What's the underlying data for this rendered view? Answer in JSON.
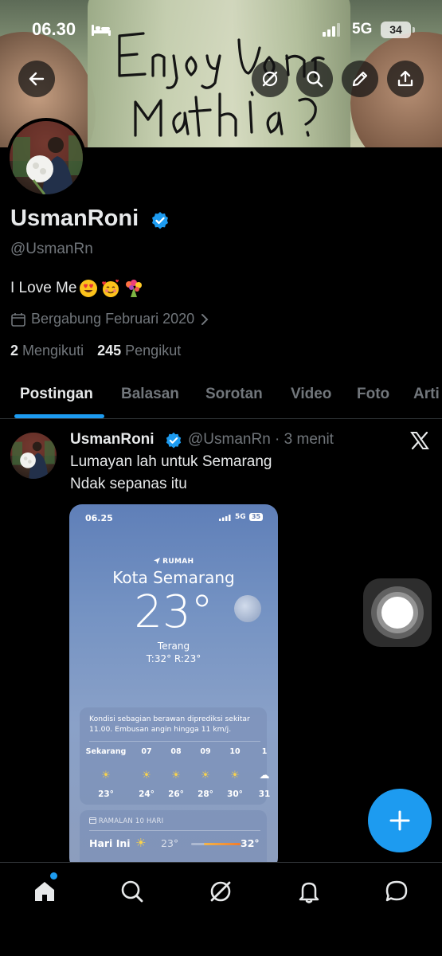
{
  "status_bar": {
    "time": "06.30",
    "network": "5G",
    "battery": "34"
  },
  "profile": {
    "display_name": "UsmanRoni",
    "handle": "@UsmanRn",
    "bio": "I Love Me",
    "joined": "Bergabung Februari 2020",
    "following_count": "2",
    "following_label": "Mengikuti",
    "followers_count": "245",
    "followers_label": "Pengikut"
  },
  "tabs": [
    {
      "label": "Postingan",
      "active": true
    },
    {
      "label": "Balasan"
    },
    {
      "label": "Sorotan"
    },
    {
      "label": "Video"
    },
    {
      "label": "Foto"
    },
    {
      "label": "Arti"
    }
  ],
  "post": {
    "name": "UsmanRoni",
    "meta": "@UsmanRn · 3 menit",
    "line1": "Lumayan lah untuk Semarang",
    "line2": "Ndak sepanas itu"
  },
  "weather_screenshot": {
    "time": "06.25",
    "network": "5G",
    "battery": "35",
    "home_label": "RUMAH",
    "city": "Kota Semarang",
    "temp": "23°",
    "condition": "Terang",
    "high_low": "T:32°  R:23°",
    "summary": "Kondisi sebagian berawan diprediksi sekitar 11.00. Embusan angin hingga 11 km/j.",
    "hours": [
      "Sekarang",
      "07",
      "08",
      "09",
      "10",
      "1"
    ],
    "hour_temps": [
      "23°",
      "24°",
      "26°",
      "28°",
      "30°",
      "31"
    ],
    "forecast_label": "RAMALAN 10 HARI",
    "today": "Hari Ini",
    "today_low": "23°",
    "today_high": "32°"
  },
  "colors": {
    "accent": "#1d9bf0",
    "background": "#000000",
    "secondary_text": "#71767b"
  }
}
